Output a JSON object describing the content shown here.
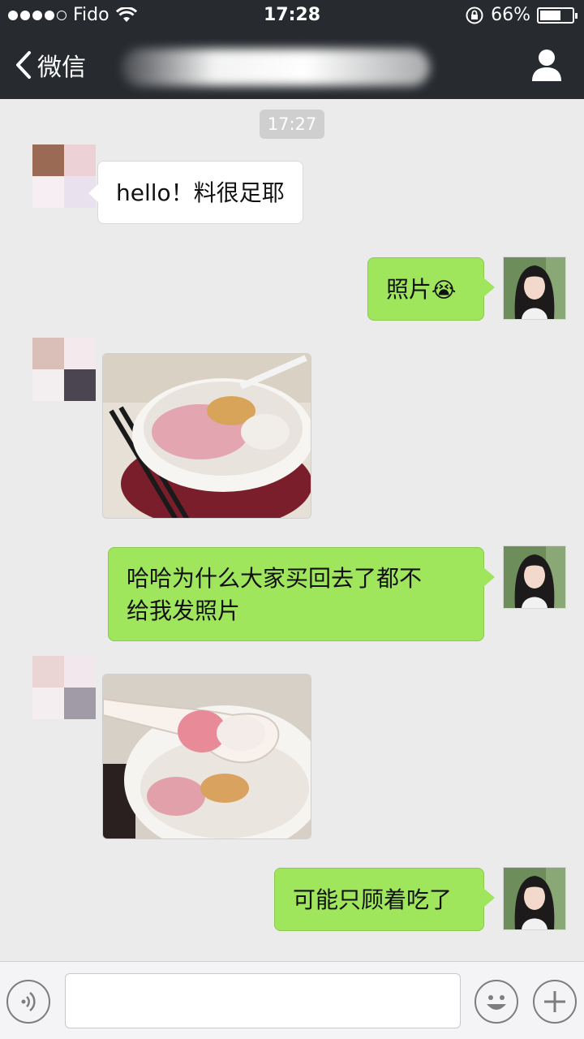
{
  "status_bar": {
    "carrier": "Fido",
    "time": "17:28",
    "battery_percent_label": "66%",
    "battery_level": 0.66,
    "signal_bars": 4,
    "icons": [
      "wifi-icon",
      "rotation-lock-icon",
      "battery-icon"
    ]
  },
  "nav": {
    "back_label": "微信",
    "icons": [
      "chevron-left-icon",
      "person-icon"
    ]
  },
  "chat": {
    "timestamp": "17:27",
    "messages": [
      {
        "from": "contact",
        "type": "text",
        "text": "hello！料很足耶"
      },
      {
        "from": "me",
        "type": "text",
        "text": "照片",
        "emoji": "😭"
      },
      {
        "from": "contact",
        "type": "image",
        "content": "food-photo-bowl"
      },
      {
        "from": "me",
        "type": "text",
        "line1": "哈哈为什么大家买回去了都不",
        "line2": "给我发照片"
      },
      {
        "from": "contact",
        "type": "image",
        "content": "food-photo-spoon"
      },
      {
        "from": "me",
        "type": "text",
        "text": "可能只顾着吃了"
      }
    ]
  },
  "input_bar": {
    "input_value": "",
    "icons": [
      "voice-icon",
      "emoji-icon",
      "plus-icon"
    ]
  },
  "colors": {
    "bar_bg": "#272a2f",
    "chat_bg": "#ebebeb",
    "outgoing_bubble": "#9fe65c",
    "incoming_bubble": "#ffffff"
  }
}
